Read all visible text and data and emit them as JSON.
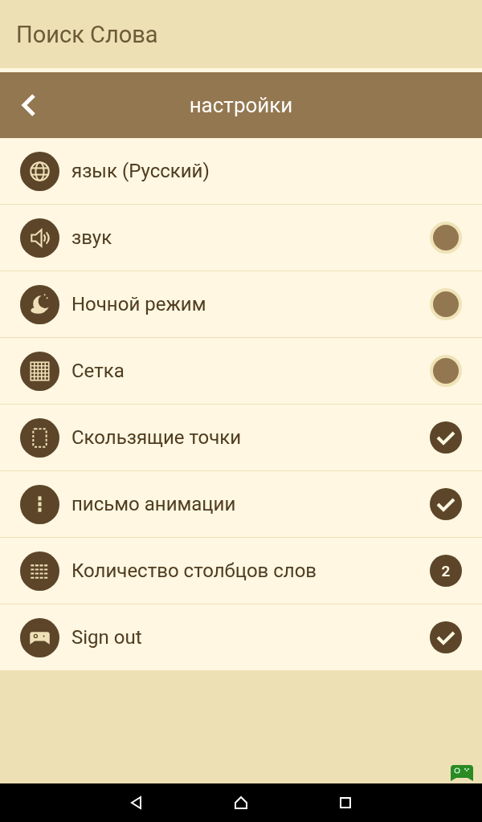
{
  "app_bar": {
    "title": "Поиск Слова"
  },
  "header": {
    "title": "настройки"
  },
  "settings": [
    {
      "kind": "plain",
      "label": "язык (Русский)"
    },
    {
      "kind": "toggle",
      "label": "звук",
      "checked": false
    },
    {
      "kind": "toggle",
      "label": "Ночной режим",
      "checked": false
    },
    {
      "kind": "toggle",
      "label": "Сетка",
      "checked": false
    },
    {
      "kind": "toggle",
      "label": "Скользящие точки",
      "checked": true
    },
    {
      "kind": "toggle",
      "label": "письмо анимации",
      "checked": true
    },
    {
      "kind": "count",
      "label": "Количество столбцов слов",
      "value": "2"
    },
    {
      "kind": "toggle",
      "label": "Sign out",
      "checked": true
    }
  ]
}
